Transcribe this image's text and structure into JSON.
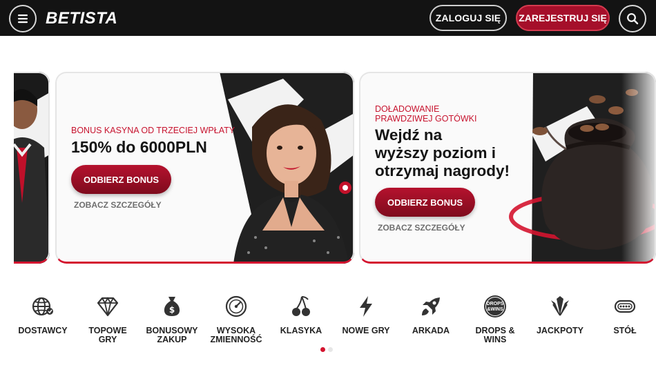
{
  "header": {
    "logo_text": "BETISTA",
    "login_label": "ZALOGUJ SIĘ",
    "register_label": "ZAREJESTRUJ SIĘ"
  },
  "promos": [
    {
      "small_title": "BONUS KASYNA OD TRZECIEJ WPŁATY",
      "big_title": "150% do 6000PLN",
      "cta_label": "ODBIERZ BONUS",
      "details_label": "ZOBACZ SZCZEGÓŁY"
    },
    {
      "small_title_line1": "DOŁADOWANIE",
      "small_title_line2": "PRAWDZIWEJ GOTÓWKI",
      "big_title_line1": "Wejdź na",
      "big_title_line2": "wyższy poziom i",
      "big_title_line3": "otrzymaj nagrody!",
      "cta_label": "ODBIERZ BONUS",
      "details_label": "ZOBACZ SZCZEGÓŁY"
    }
  ],
  "categories": [
    {
      "line1": "DOSTAWCY",
      "line2": "",
      "icon": "globe-icon"
    },
    {
      "line1": "TOPOWE",
      "line2": "GRY",
      "icon": "diamond-icon"
    },
    {
      "line1": "BONUSOWY",
      "line2": "ZAKUP",
      "icon": "money-bag-icon"
    },
    {
      "line1": "WYSOKA",
      "line2": "ZMIENNOŚĆ",
      "icon": "gauge-icon"
    },
    {
      "line1": "KLASYKA",
      "line2": "",
      "icon": "cherries-icon"
    },
    {
      "line1": "NOWE GRY",
      "line2": "",
      "icon": "lightning-icon"
    },
    {
      "line1": "ARKADA",
      "line2": "",
      "icon": "rocket-icon"
    },
    {
      "line1": "DROPS &",
      "line2": "WINS",
      "icon": "drops-wins-icon",
      "badge_line1": "DROPS",
      "badge_line2": "&WINS"
    },
    {
      "line1": "JACKPOTY",
      "line2": "",
      "icon": "jackpot-icon"
    },
    {
      "line1": "STÓŁ",
      "line2": "",
      "icon": "table-icon"
    }
  ],
  "colors": {
    "header_bg": "#131313",
    "accent": "#a50f2a",
    "promo_red": "#c7132e",
    "dot_active": "#d4142f",
    "dot_inactive": "#e6e6e6"
  }
}
